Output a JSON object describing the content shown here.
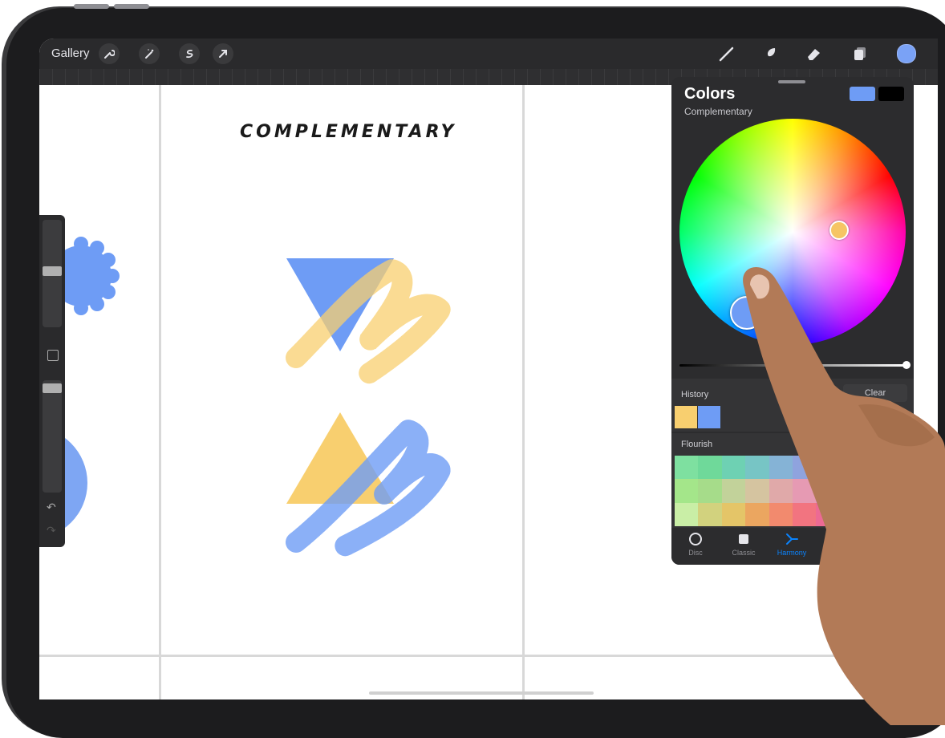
{
  "toolbar": {
    "gallery_label": "Gallery",
    "left_tools": [
      "wrench-icon",
      "magic-wand-icon",
      "selection-icon",
      "transform-arrow-icon"
    ],
    "right_tools": [
      "brush-icon",
      "smudge-icon",
      "eraser-icon",
      "layers-icon"
    ],
    "current_color": "#7aa2f6"
  },
  "canvas": {
    "heading": "COMPLEMENTARY",
    "shape_colors": {
      "blue": "#6e9cf5",
      "yellow": "#f8cf6f"
    }
  },
  "colors_panel": {
    "title": "Colors",
    "mode": "Complementary",
    "primary_swatch": "#6e9cf5",
    "secondary_swatch": "#000000",
    "history_label": "History",
    "clear_label": "Clear",
    "history_swatches": [
      "#f8cf6f",
      "#6e9cf5"
    ],
    "palette_label": "Flourish",
    "palette_colors": [
      "#7ee0a0",
      "#6fd99a",
      "#6ed1b3",
      "#77c5c5",
      "#85b3d6",
      "#8fa3de",
      "#9e97d8",
      "#b595d2",
      "#c995c7",
      "#d996b9",
      "#a4e68a",
      "#a6dc8a",
      "#c2d29a",
      "#d5c4a0",
      "#e0a9a9",
      "#e69ab3",
      "#e092c2",
      "#cf92cf",
      "#b596d6",
      "#9da0db",
      "#c9eea6",
      "#d2d27e",
      "#e4c568",
      "#eba660",
      "#f28a6e",
      "#f27480",
      "#ec6a94",
      "#dc6fae",
      "#c579c6",
      "#a987d2"
    ],
    "tabs": [
      {
        "label": "Disc",
        "icon": "disc-icon"
      },
      {
        "label": "Classic",
        "icon": "classic-square-icon"
      },
      {
        "label": "Harmony",
        "icon": "harmony-icon"
      }
    ],
    "active_tab": "Harmony"
  }
}
